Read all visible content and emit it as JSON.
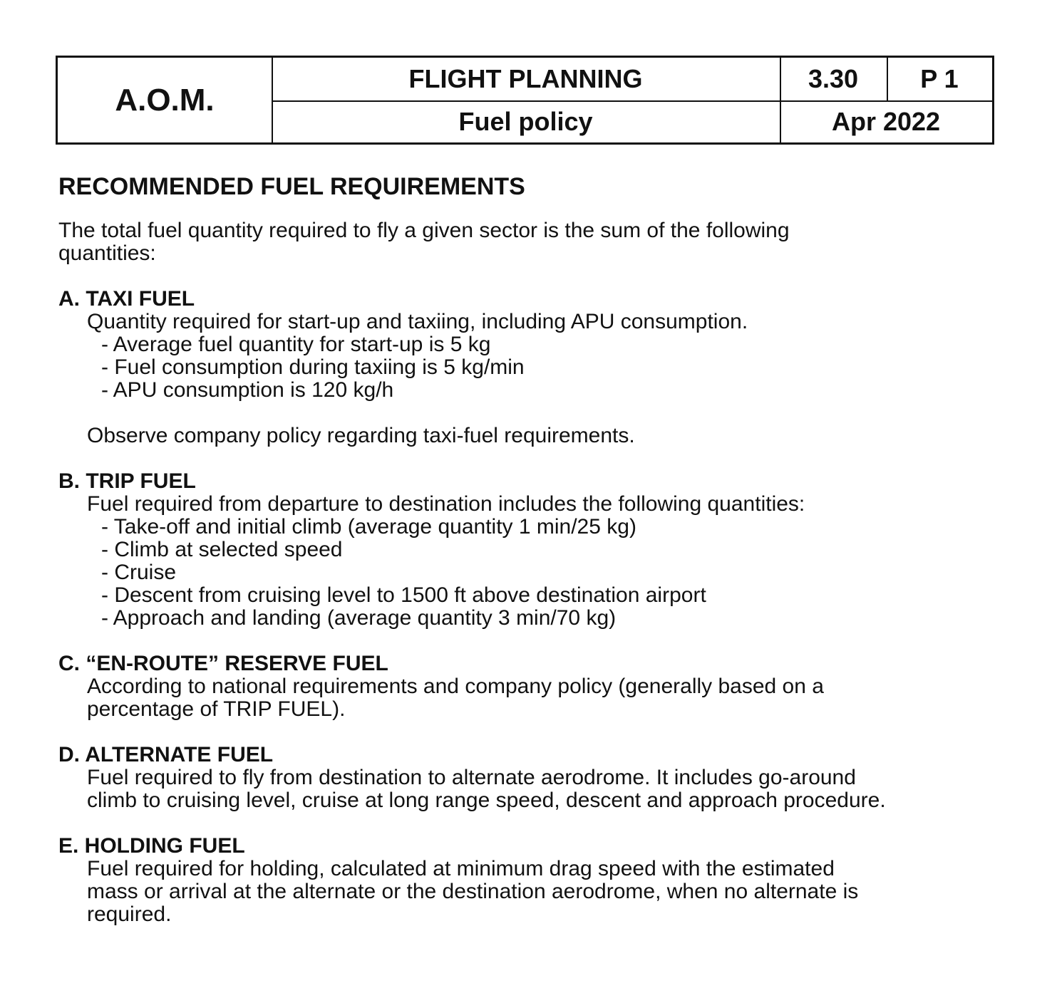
{
  "header": {
    "manual": "A.O.M.",
    "chapter": "FLIGHT PLANNING",
    "subject": "Fuel policy",
    "section": "3.30",
    "page": "P 1",
    "date": "Apr 2022"
  },
  "title": "RECOMMENDED FUEL REQUIREMENTS",
  "intro": [
    "The total fuel quantity required to fly a given sector is the sum of the following",
    "quantities:"
  ],
  "sections": [
    {
      "heading": "A. TAXI FUEL",
      "body": [
        "Quantity required for start-up and taxiing, including APU consumption."
      ],
      "bullets": [
        "- Average fuel quantity for start-up is 5 kg",
        "- Fuel consumption during taxiing is 5 kg/min",
        "- APU consumption is 120 kg/h"
      ],
      "note": "Observe company policy regarding taxi-fuel requirements."
    },
    {
      "heading": "B. TRIP FUEL",
      "body": [
        "Fuel required from departure to destination includes the following quantities:"
      ],
      "bullets": [
        "- Take-off and initial climb (average quantity 1 min/25 kg)",
        "- Climb at selected speed",
        "- Cruise",
        "- Descent from cruising level to 1500 ft above destination airport",
        "- Approach and landing (average quantity 3 min/70 kg)"
      ]
    },
    {
      "heading": "C. “EN-ROUTE” RESERVE FUEL",
      "body": [
        "According to national requirements and company policy (generally based on a",
        "percentage of TRIP FUEL)."
      ]
    },
    {
      "heading": "D. ALTERNATE FUEL",
      "body": [
        "Fuel required to fly from destination to alternate aerodrome. It includes go-around",
        "climb to cruising level, cruise at long range speed, descent and approach procedure."
      ]
    },
    {
      "heading": "E. HOLDING FUEL",
      "body": [
        "Fuel required for holding, calculated at minimum drag speed with the estimated",
        "mass or arrival at the alternate or the destination aerodrome, when no alternate is",
        "required."
      ]
    }
  ]
}
